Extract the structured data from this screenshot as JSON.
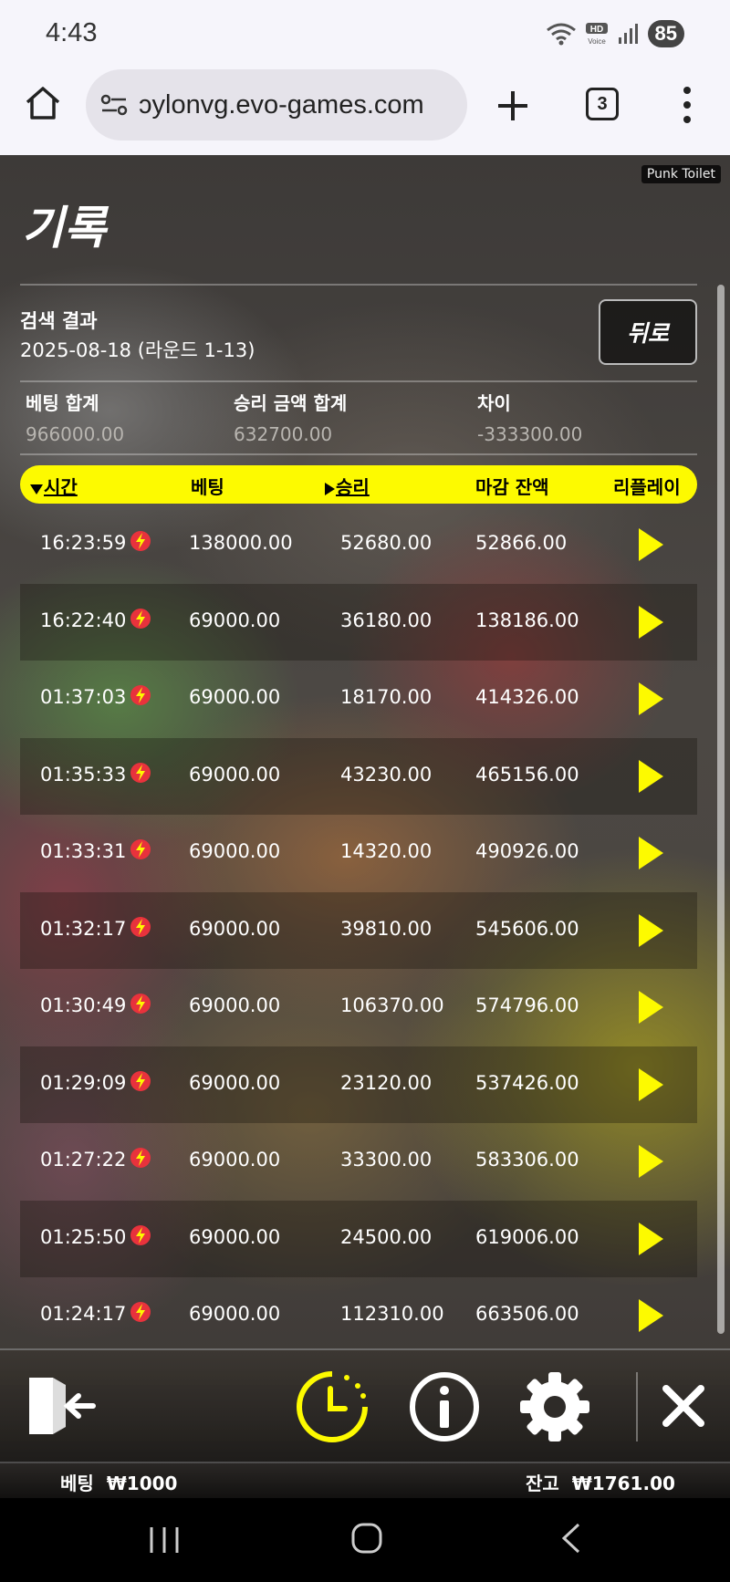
{
  "status_bar": {
    "time": "4:43",
    "battery": "85"
  },
  "browser": {
    "url": "ɔylonvg.evo-games.com",
    "tab_count": "3"
  },
  "game": {
    "tag": "Punk Toilet",
    "title": "기록",
    "search_label": "검색 결과",
    "search_value": "2025-08-18 (라운드 1-13)",
    "back_label": "뒤로",
    "summary": {
      "bet_total_label": "베팅 합계",
      "bet_total_value": "966000.00",
      "win_total_label": "승리 금액 합계",
      "win_total_value": "632700.00",
      "diff_label": "차이",
      "diff_value": "-333300.00"
    },
    "table_header": {
      "time": "시간",
      "bet": "베팅",
      "win": "승리",
      "balance": "마감 잔액",
      "replay": "리플레이"
    },
    "rows": [
      {
        "time": "16:23:59",
        "bet": "138000.00",
        "win": "52680.00",
        "balance": "52866.00"
      },
      {
        "time": "16:22:40",
        "bet": "69000.00",
        "win": "36180.00",
        "balance": "138186.00"
      },
      {
        "time": "01:37:03",
        "bet": "69000.00",
        "win": "18170.00",
        "balance": "414326.00"
      },
      {
        "time": "01:35:33",
        "bet": "69000.00",
        "win": "43230.00",
        "balance": "465156.00"
      },
      {
        "time": "01:33:31",
        "bet": "69000.00",
        "win": "14320.00",
        "balance": "490926.00"
      },
      {
        "time": "01:32:17",
        "bet": "69000.00",
        "win": "39810.00",
        "balance": "545606.00"
      },
      {
        "time": "01:30:49",
        "bet": "69000.00",
        "win": "106370.00",
        "balance": "574796.00"
      },
      {
        "time": "01:29:09",
        "bet": "69000.00",
        "win": "23120.00",
        "balance": "537426.00"
      },
      {
        "time": "01:27:22",
        "bet": "69000.00",
        "win": "33300.00",
        "balance": "583306.00"
      },
      {
        "time": "01:25:50",
        "bet": "69000.00",
        "win": "24500.00",
        "balance": "619006.00"
      },
      {
        "time": "01:24:17",
        "bet": "69000.00",
        "win": "112310.00",
        "balance": "663506.00"
      }
    ],
    "bottom": {
      "bet_label": "베팅",
      "bet_value": "₩1000",
      "balance_label": "잔고",
      "balance_value": "₩1761.00"
    },
    "colors": {
      "accent": "#fdfa00",
      "bolt": "#e8323c"
    }
  }
}
